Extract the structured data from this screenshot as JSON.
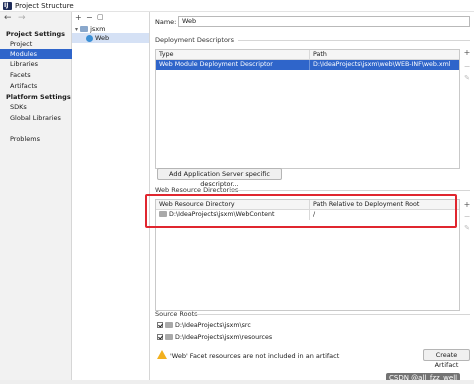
{
  "window": {
    "title": "Project Structure"
  },
  "nav": {
    "back": "←",
    "forward": "→"
  },
  "sidebar": {
    "project_settings_header": "Project Settings",
    "project_settings": [
      "Project",
      "Modules",
      "Libraries",
      "Facets",
      "Artifacts"
    ],
    "platform_settings_header": "Platform Settings",
    "platform_settings": [
      "SDKs",
      "Global Libraries"
    ],
    "other": [
      "Problems"
    ],
    "selected": "Modules"
  },
  "module_tree": {
    "toolbar": {
      "add": "+",
      "remove": "−",
      "copy": "▢"
    },
    "root": "jsxm",
    "child": "Web"
  },
  "facet": {
    "name_label": "Name:",
    "name_value": "Web",
    "descriptors": {
      "section_title": "Deployment Descriptors",
      "columns": [
        "Type",
        "Path"
      ],
      "rows": [
        {
          "type": "Web Module Deployment Descriptor",
          "path": "D:\\IdeaProjects\\jsxm\\web\\WEB-INF\\web.xml"
        }
      ],
      "add_button": "Add Application Server specific descriptor..."
    },
    "resource_dirs": {
      "section_title": "Web Resource Directories",
      "columns": [
        "Web Resource Directory",
        "Path Relative to Deployment Root"
      ],
      "rows": [
        {
          "dir": "D:\\IdeaProjects\\jsxm\\WebContent",
          "rel": "/"
        }
      ]
    },
    "source_roots": {
      "section_title": "Source Roots",
      "items": [
        "D:\\IdeaProjects\\jsxm\\src",
        "D:\\IdeaProjects\\jsxm\\resources"
      ]
    },
    "warning": "'Web' Facet resources are not included in an artifact",
    "create_artifact_button": "Create Artifact"
  },
  "side_tools": {
    "add": "+",
    "remove": "−",
    "edit": "✎"
  },
  "watermark": "CSDN @all_fzz_well"
}
